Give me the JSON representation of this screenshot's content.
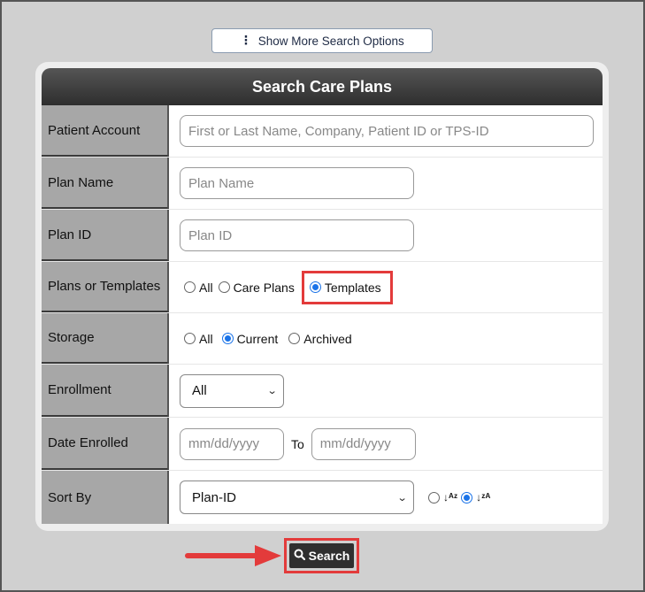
{
  "toolbar": {
    "more_options_label": "Show More Search Options"
  },
  "form": {
    "title": "Search Care Plans",
    "patient_account": {
      "label": "Patient Account",
      "placeholder": "First or Last Name, Company, Patient ID or TPS-ID"
    },
    "plan_name": {
      "label": "Plan Name",
      "placeholder": "Plan Name"
    },
    "plan_id": {
      "label": "Plan ID",
      "placeholder": "Plan ID"
    },
    "plans_or_templates": {
      "label": "Plans or Templates",
      "options": [
        "All",
        "Care Plans",
        "Templates"
      ],
      "selected": "Templates"
    },
    "storage": {
      "label": "Storage",
      "options": [
        "All",
        "Current",
        "Archived"
      ],
      "selected": "Current"
    },
    "enrollment": {
      "label": "Enrollment",
      "value": "All"
    },
    "date_enrolled": {
      "label": "Date Enrolled",
      "from_placeholder": "mm/dd/yyyy",
      "to_label": "To",
      "to_placeholder": "mm/dd/yyyy"
    },
    "sort_by": {
      "label": "Sort By",
      "value": "Plan-ID",
      "asc_selected": false,
      "desc_selected": true
    }
  },
  "actions": {
    "search_label": "Search"
  },
  "colors": {
    "highlight": "#e33b3b",
    "radio_on": "#1a73e8",
    "header": "#333333"
  }
}
